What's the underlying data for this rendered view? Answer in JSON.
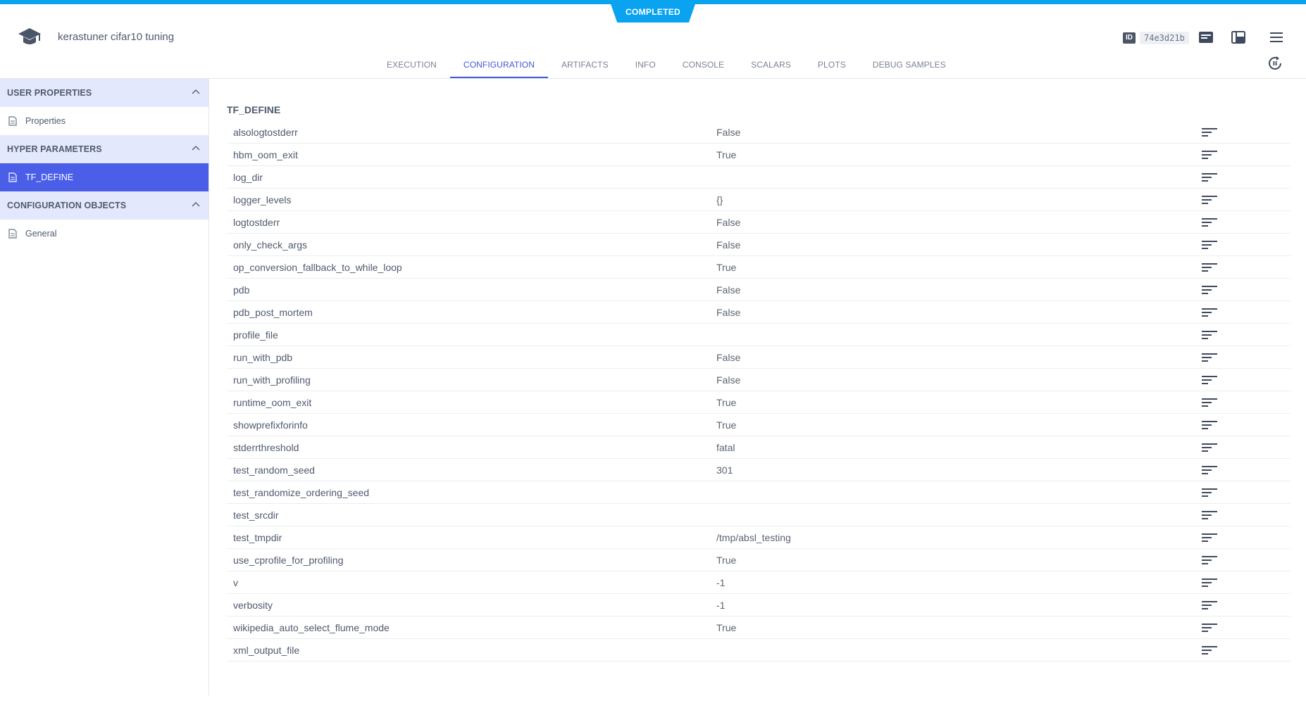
{
  "status": "COMPLETED",
  "task": {
    "title": "kerastuner cifar10 tuning",
    "id_label": "ID",
    "id": "74e3d21b"
  },
  "header_icons": {
    "details": "details-icon",
    "panel": "panel-layout-icon",
    "menu": "hamburger-menu-icon",
    "refresh": "auto-refresh-icon"
  },
  "tabs": [
    {
      "label": "EXECUTION"
    },
    {
      "label": "CONFIGURATION",
      "active": true
    },
    {
      "label": "ARTIFACTS"
    },
    {
      "label": "INFO"
    },
    {
      "label": "CONSOLE"
    },
    {
      "label": "SCALARS"
    },
    {
      "label": "PLOTS"
    },
    {
      "label": "DEBUG SAMPLES"
    }
  ],
  "sidebar": {
    "sections": [
      {
        "title": "USER PROPERTIES",
        "items": [
          {
            "label": "Properties"
          }
        ]
      },
      {
        "title": "HYPER PARAMETERS",
        "items": [
          {
            "label": "TF_DEFINE",
            "active": true
          }
        ]
      },
      {
        "title": "CONFIGURATION OBJECTS",
        "items": [
          {
            "label": "General"
          }
        ]
      }
    ]
  },
  "main": {
    "section_title": "TF_DEFINE",
    "rows": [
      {
        "key": "alsologtostderr",
        "value": "False"
      },
      {
        "key": "hbm_oom_exit",
        "value": "True"
      },
      {
        "key": "log_dir",
        "value": ""
      },
      {
        "key": "logger_levels",
        "value": "{}"
      },
      {
        "key": "logtostderr",
        "value": "False"
      },
      {
        "key": "only_check_args",
        "value": "False"
      },
      {
        "key": "op_conversion_fallback_to_while_loop",
        "value": "True"
      },
      {
        "key": "pdb",
        "value": "False"
      },
      {
        "key": "pdb_post_mortem",
        "value": "False"
      },
      {
        "key": "profile_file",
        "value": ""
      },
      {
        "key": "run_with_pdb",
        "value": "False"
      },
      {
        "key": "run_with_profiling",
        "value": "False"
      },
      {
        "key": "runtime_oom_exit",
        "value": "True"
      },
      {
        "key": "showprefixforinfo",
        "value": "True"
      },
      {
        "key": "stderrthreshold",
        "value": "fatal"
      },
      {
        "key": "test_random_seed",
        "value": "301"
      },
      {
        "key": "test_randomize_ordering_seed",
        "value": ""
      },
      {
        "key": "test_srcdir",
        "value": ""
      },
      {
        "key": "test_tmpdir",
        "value": "/tmp/absl_testing"
      },
      {
        "key": "use_cprofile_for_profiling",
        "value": "True"
      },
      {
        "key": "v",
        "value": "-1"
      },
      {
        "key": "verbosity",
        "value": "-1"
      },
      {
        "key": "wikipedia_auto_select_flume_mode",
        "value": "True"
      },
      {
        "key": "xml_output_file",
        "value": ""
      }
    ]
  },
  "colors": {
    "accent": "#0aa3f0",
    "primary": "#4a5ee8",
    "section_bg": "#e4e8fc"
  }
}
